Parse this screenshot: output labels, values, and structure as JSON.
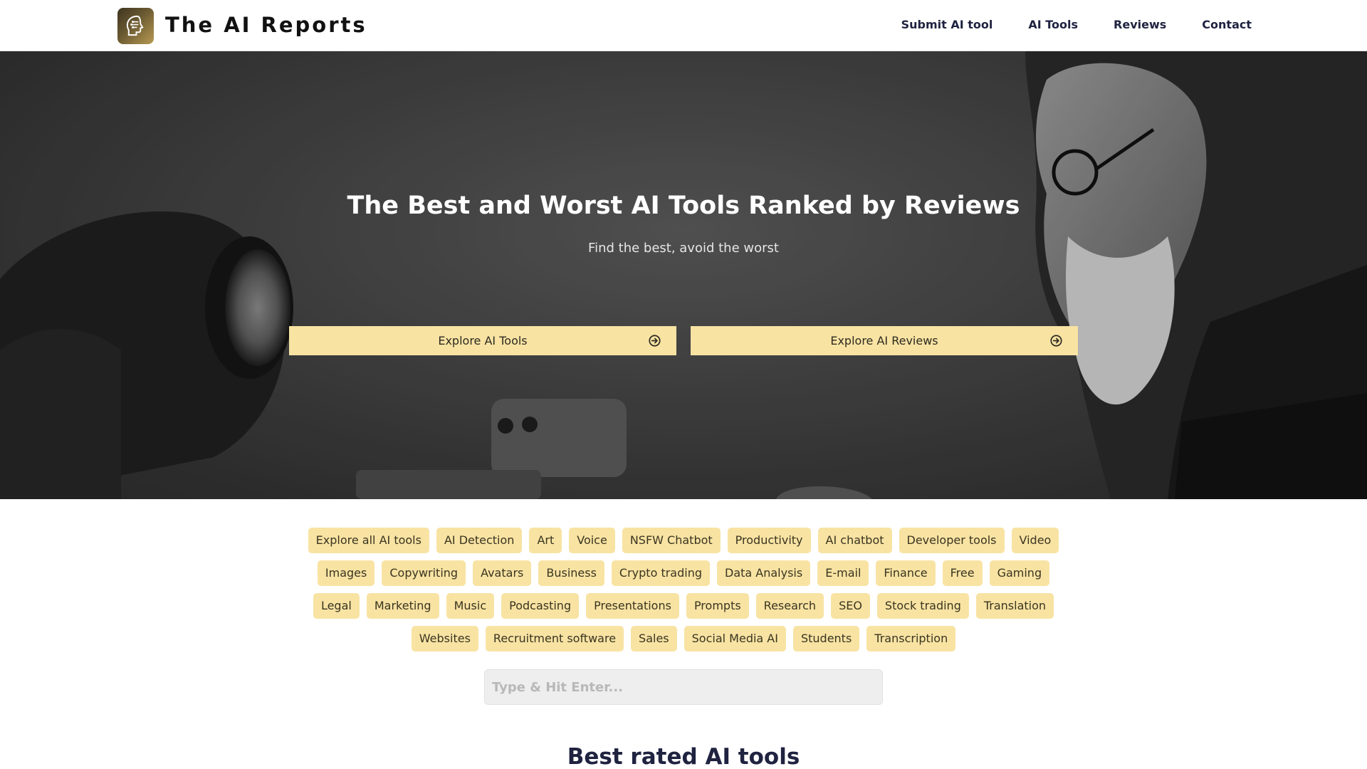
{
  "header": {
    "brand": "The AI Reports",
    "logo_icon": "head-circuit-icon",
    "nav": [
      {
        "label": "Submit AI tool"
      },
      {
        "label": "AI Tools"
      },
      {
        "label": "Reviews"
      },
      {
        "label": "Contact"
      }
    ]
  },
  "hero": {
    "title": "The Best and Worst AI Tools Ranked by Reviews",
    "subtitle": "Find the best, avoid the worst",
    "buttons": [
      {
        "label": "Explore AI Tools",
        "icon": "arrow-right-circle-icon"
      },
      {
        "label": "Explore AI Reviews",
        "icon": "arrow-right-circle-icon"
      }
    ]
  },
  "tags": [
    "Explore all AI tools",
    "AI Detection",
    "Art",
    "Voice",
    "NSFW Chatbot",
    "Productivity",
    "AI chatbot",
    "Developer tools",
    "Video",
    "Images",
    "Copywriting",
    "Avatars",
    "Business",
    "Crypto trading",
    "Data Analysis",
    "E-mail",
    "Finance",
    "Free",
    "Gaming",
    "Legal",
    "Marketing",
    "Music",
    "Podcasting",
    "Presentations",
    "Prompts",
    "Research",
    "SEO",
    "Stock trading",
    "Translation",
    "Websites",
    "Recruitment software",
    "Sales",
    "Social Media AI",
    "Students",
    "Transcription"
  ],
  "search": {
    "placeholder": "Type & Hit Enter...",
    "value": ""
  },
  "section": {
    "title": "Best rated AI tools"
  },
  "colors": {
    "accent": "#f8e3a3",
    "navy": "#1f2340",
    "logo_gold": "#b89a52"
  }
}
